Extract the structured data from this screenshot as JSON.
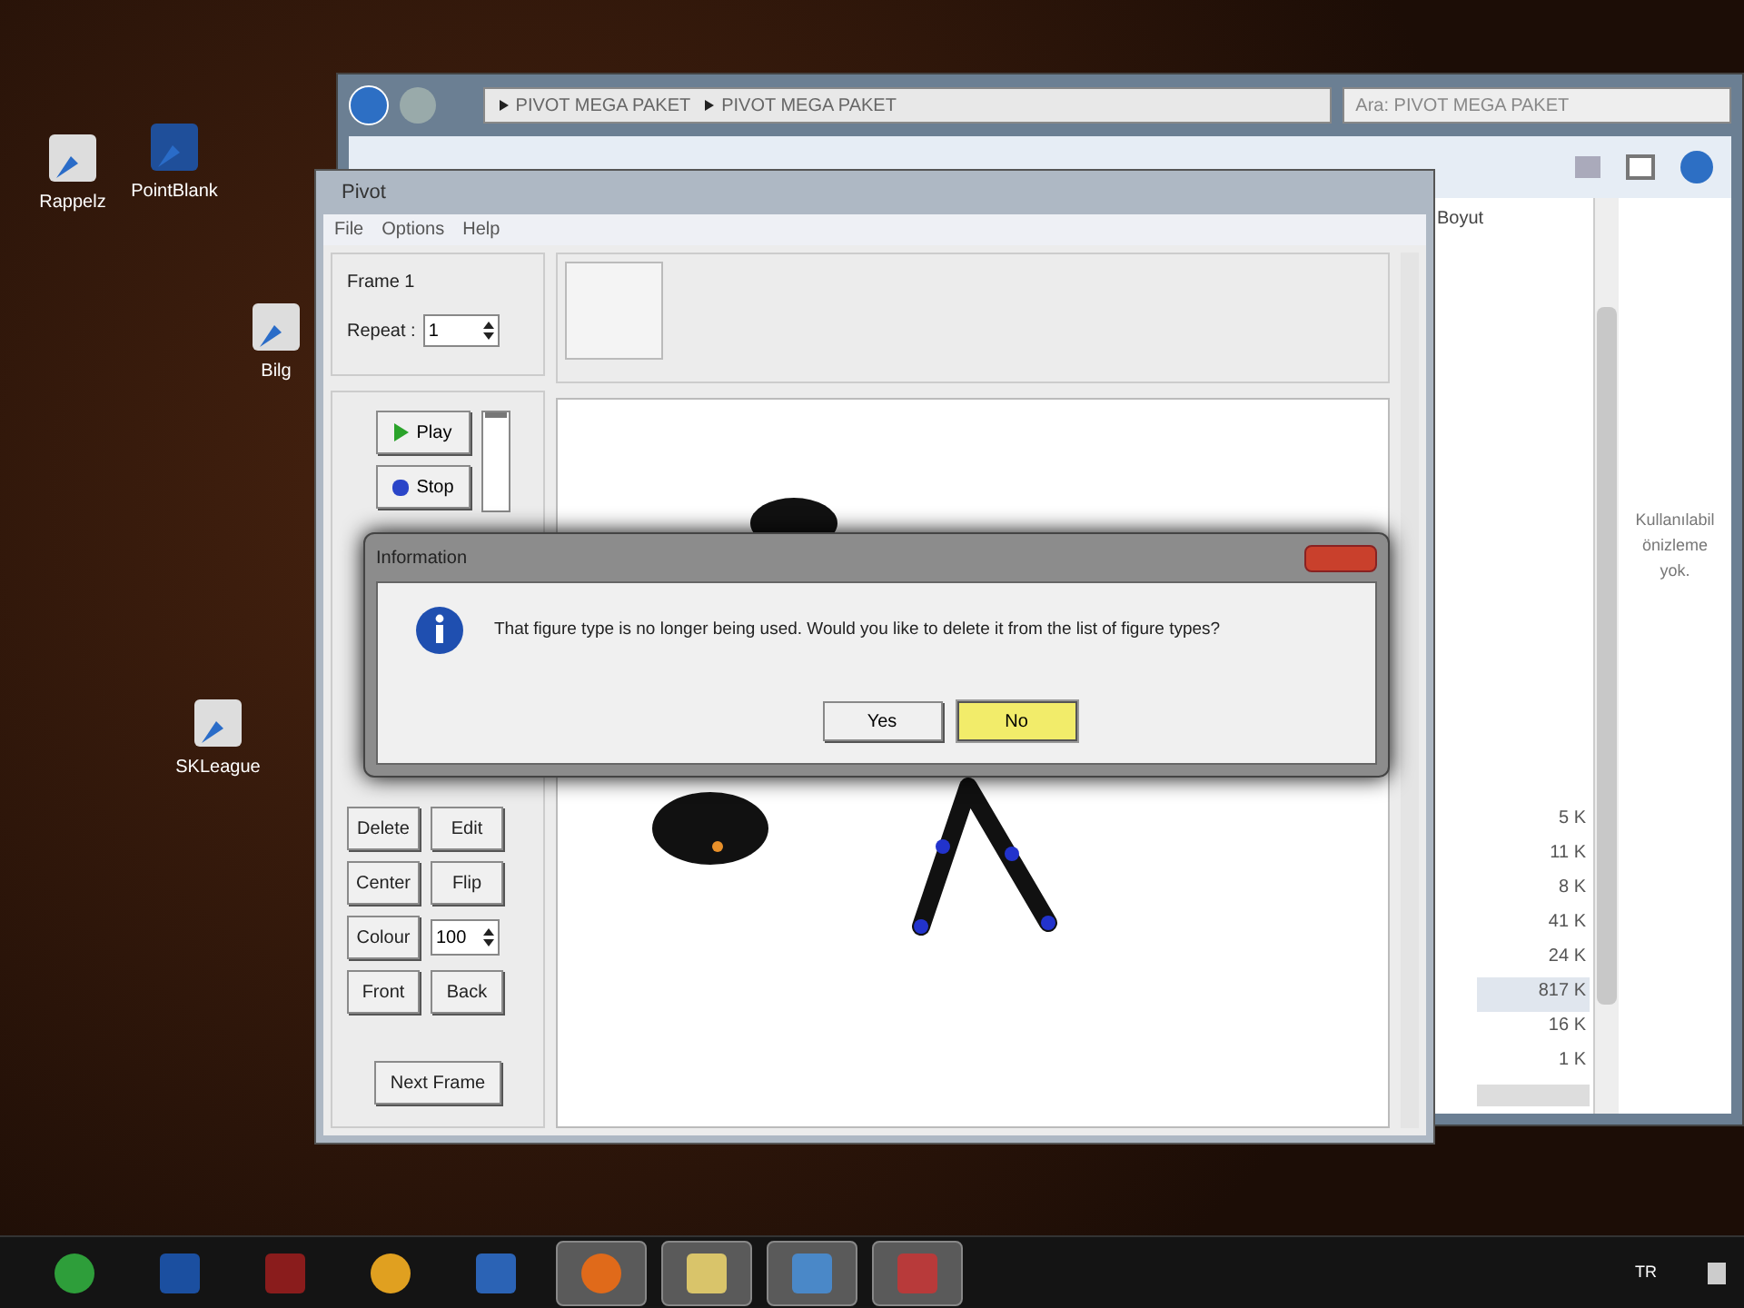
{
  "desktop_icons": [
    {
      "label": "Rappelz"
    },
    {
      "label": "PointBlank"
    },
    {
      "label": "Bilg"
    },
    {
      "label": "SKLeague"
    }
  ],
  "explorer": {
    "breadcrumb": [
      "PIVOT MEGA PAKET",
      "PIVOT MEGA PAKET"
    ],
    "search": {
      "placeholder": "Ara: PIVOT MEGA PAKET"
    },
    "column": "Boyut",
    "sizes": [
      {
        "text": "5 K",
        "selected": false
      },
      {
        "text": "11 K",
        "selected": false
      },
      {
        "text": "8 K",
        "selected": false
      },
      {
        "text": "41 K",
        "selected": false
      },
      {
        "text": "24 K",
        "selected": false
      },
      {
        "text": "817 K",
        "selected": true
      },
      {
        "text": "16 K",
        "selected": false
      },
      {
        "text": "1 K",
        "selected": false
      }
    ],
    "preview": [
      "Kullanılabil",
      "önizleme",
      "yok."
    ]
  },
  "pivot": {
    "title": "Pivot",
    "menu": [
      "File",
      "Options",
      "Help"
    ],
    "frame_label": "Frame 1",
    "repeat_label": "Repeat :",
    "repeat_value": "1",
    "play": "Play",
    "stop": "Stop",
    "figure_controls": [
      [
        {
          "kind": "button",
          "label": "Delete"
        },
        {
          "kind": "button",
          "label": "Edit"
        }
      ],
      [
        {
          "kind": "button",
          "label": "Center"
        },
        {
          "kind": "button",
          "label": "Flip"
        }
      ],
      [
        {
          "kind": "button",
          "label": "Colour"
        },
        {
          "kind": "spinner",
          "label": "100"
        }
      ],
      [
        {
          "kind": "button",
          "label": "Front"
        },
        {
          "kind": "button",
          "label": "Back"
        }
      ]
    ],
    "next_frame": "Next Frame",
    "speed_slider": {
      "level": 0
    }
  },
  "dialog": {
    "title": "Information",
    "message": "That figure type is no longer being used. Would you like to delete it from the list of figure types?",
    "buttons": [
      {
        "label": "Yes",
        "selected": false
      },
      {
        "label": "No",
        "selected": true
      }
    ]
  },
  "taskbar": {
    "apps": [
      {
        "running": false
      },
      {
        "running": false
      },
      {
        "running": false
      },
      {
        "running": false
      },
      {
        "running": false
      },
      {
        "running": true
      },
      {
        "running": true
      },
      {
        "running": true
      },
      {
        "running": true
      }
    ],
    "language": "TR"
  }
}
